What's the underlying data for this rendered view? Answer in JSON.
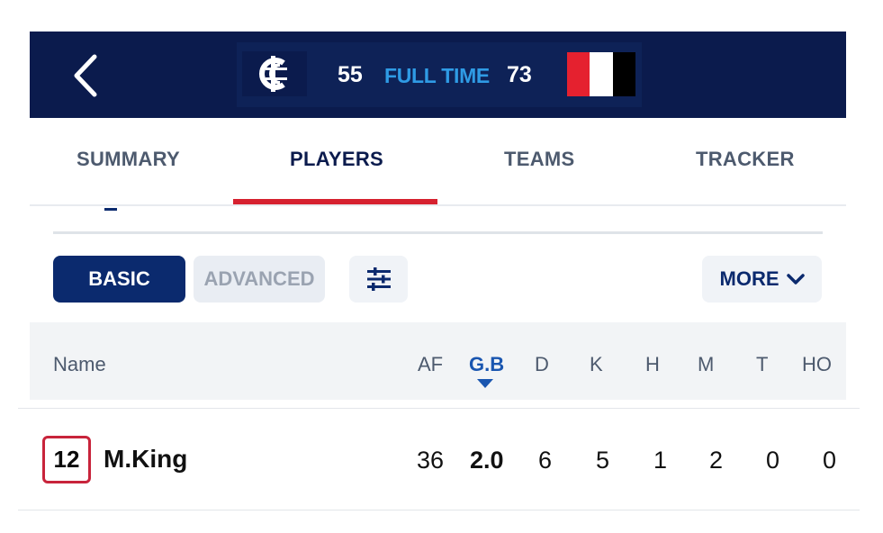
{
  "header": {
    "home_score": "55",
    "status": "FULL TIME",
    "away_score": "73",
    "colors": {
      "bg": "#0b1b4d",
      "status": "#2f9be5",
      "opp_stripes": [
        "#e5212f",
        "#ffffff",
        "#000000"
      ]
    }
  },
  "tabs": [
    {
      "label": "SUMMARY"
    },
    {
      "label": "PLAYERS",
      "active": true
    },
    {
      "label": "TEAMS"
    },
    {
      "label": "TRACKER"
    }
  ],
  "controls": {
    "basic_label": "BASIC",
    "advanced_label": "ADVANCED",
    "more_label": "MORE"
  },
  "table": {
    "headers": [
      "Name",
      "AF",
      "G.B",
      "D",
      "K",
      "H",
      "M",
      "T",
      "HO"
    ],
    "sorted_column": "G.B",
    "rows": [
      {
        "number": "12",
        "name": "M.King",
        "af": "36",
        "gb": "2.0",
        "d": "6",
        "k": "5",
        "h": "1",
        "m": "2",
        "t": "0",
        "ho": "0"
      }
    ]
  }
}
